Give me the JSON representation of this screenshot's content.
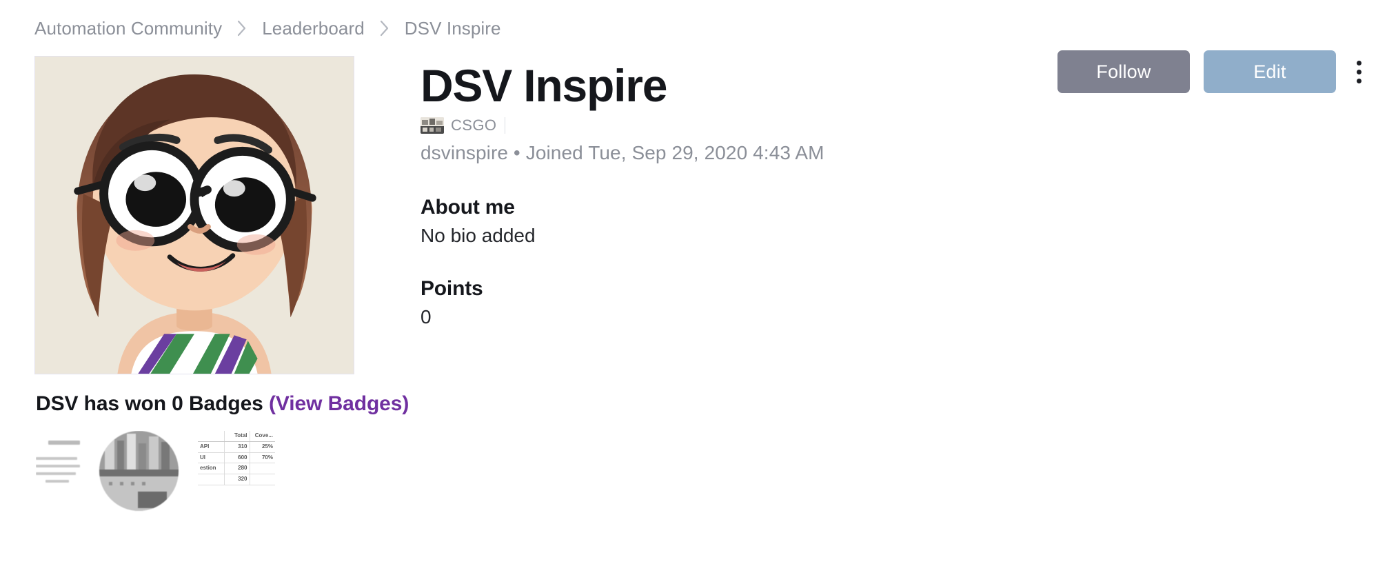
{
  "breadcrumb": {
    "items": [
      {
        "label": "Automation Community"
      },
      {
        "label": "Leaderboard"
      },
      {
        "label": "DSV Inspire"
      }
    ],
    "separator_icon": "chevron-right-icon"
  },
  "profile": {
    "name": "DSV Inspire",
    "avatar_alt": "Cartoon illustration of a girl with round glasses and brown hair",
    "game_tag": {
      "label": "CSGO",
      "thumb_icon": "game-thumbnail-icon"
    },
    "username": "dsvinspire",
    "separator": "•",
    "joined": "Joined Tue, Sep 29, 2020 4:43 AM",
    "meta_line": "dsvinspire • Joined Tue, Sep 29, 2020 4:43 AM",
    "about": {
      "heading": "About me",
      "body": "No bio added"
    },
    "points": {
      "heading": "Points",
      "value": "0"
    }
  },
  "actions": {
    "follow_label": "Follow",
    "edit_label": "Edit",
    "more_icon": "kebab-menu-icon"
  },
  "badges": {
    "heading": "DSV has won 0 Badges",
    "link_label": "(View Badges)",
    "count": "0"
  },
  "content_strip": {
    "table": {
      "headers": [
        "",
        "Total",
        "Cove..."
      ],
      "rows": [
        {
          "label": "API",
          "total": "310",
          "coverage": "25%"
        },
        {
          "label": "UI",
          "total": "600",
          "coverage": "70%"
        },
        {
          "label": "estion",
          "total": "280",
          "coverage": ""
        },
        {
          "label": "",
          "total": "320",
          "coverage": ""
        }
      ]
    }
  },
  "colors": {
    "follow_button": "#7f8190",
    "edit_button": "#90aeca",
    "badges_link": "#7030a0",
    "breadcrumb_text": "#8b8f98",
    "heading_text": "#15171c",
    "muted_text": "#8b8f98",
    "avatar_background": "#ece7db"
  }
}
